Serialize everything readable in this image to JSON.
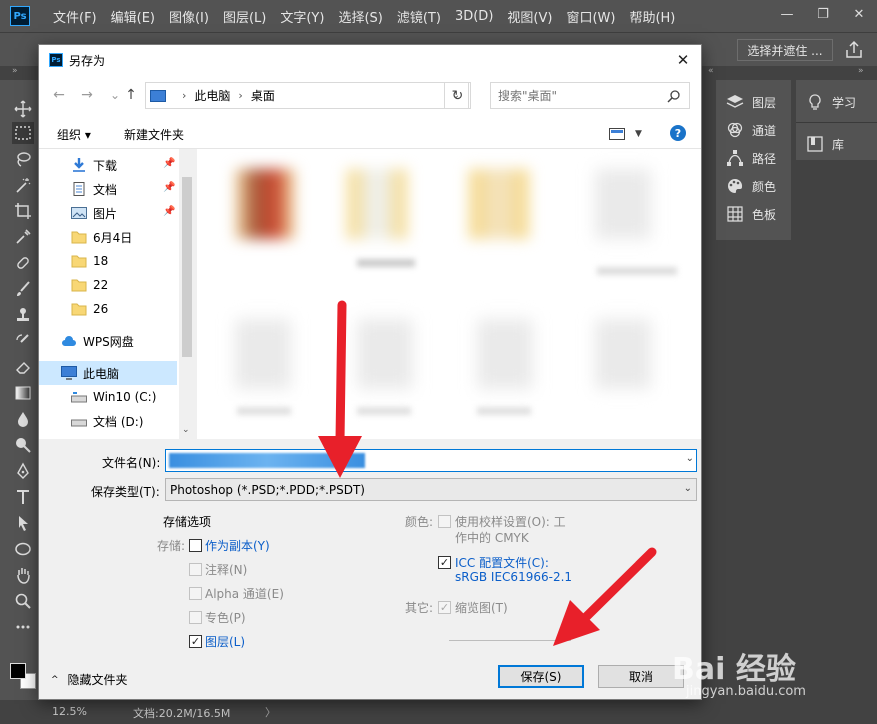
{
  "app": {
    "logo": "Ps",
    "menu": [
      "文件(F)",
      "编辑(E)",
      "图像(I)",
      "图层(L)",
      "文字(Y)",
      "选择(S)",
      "滤镜(T)",
      "3D(D)",
      "视图(V)",
      "窗口(W)",
      "帮助(H)"
    ],
    "window_controls": [
      "—",
      "❐",
      "✕"
    ],
    "select_mask_label": "选择并遮住 ...",
    "status": {
      "zoom": "12.5%",
      "doc": "文档:20.2M/16.5M",
      "arrow": "〉"
    }
  },
  "panels": {
    "mid": [
      "图层",
      "通道",
      "路径",
      "颜色",
      "色板"
    ],
    "right": [
      "学习",
      "库"
    ]
  },
  "dialog": {
    "title": "另存为",
    "close": "✕",
    "address": {
      "root": "此电脑",
      "current": "桌面"
    },
    "search_placeholder": "搜索\"桌面\"",
    "organize": "组织 ▾",
    "new_folder": "新建文件夹",
    "help": "?",
    "nav_items": [
      {
        "label": "下载",
        "icon": "download-icon",
        "pinned": true
      },
      {
        "label": "文档",
        "icon": "document-icon",
        "pinned": true
      },
      {
        "label": "图片",
        "icon": "pictures-icon",
        "pinned": true
      },
      {
        "label": "6月4日",
        "icon": "folder-icon",
        "pinned": false
      },
      {
        "label": "18",
        "icon": "folder-icon",
        "pinned": false
      },
      {
        "label": "22",
        "icon": "folder-icon",
        "pinned": false
      },
      {
        "label": "26",
        "icon": "folder-icon",
        "pinned": false
      },
      {
        "label": "WPS网盘",
        "icon": "cloud-icon",
        "pinned": false
      },
      {
        "label": "此电脑",
        "icon": "computer-icon",
        "pinned": false
      },
      {
        "label": "Win10 (C:)",
        "icon": "drive-icon",
        "pinned": false
      },
      {
        "label": "文档 (D:)",
        "icon": "drive-icon",
        "pinned": false
      }
    ],
    "filename_label": "文件名(N):",
    "filetype_label": "保存类型(T):",
    "filetype_value": "Photoshop (*.PSD;*.PDD;*.PSDT)",
    "storage_options_title": "存储选项",
    "storage_label": "存储:",
    "options_left": [
      {
        "label": "作为副本(Y)",
        "checked": false,
        "enabled": true
      },
      {
        "label": "注释(N)",
        "checked": false,
        "enabled": false
      },
      {
        "label": "Alpha 通道(E)",
        "checked": false,
        "enabled": false
      },
      {
        "label": "专色(P)",
        "checked": false,
        "enabled": false
      },
      {
        "label": "图层(L)",
        "checked": true,
        "enabled": true
      }
    ],
    "color_label": "颜色:",
    "proof_setup": {
      "line1": "使用校样设置(O):  工",
      "line2": "作中的 CMYK",
      "checked": false,
      "enabled": false
    },
    "icc_profile": {
      "line1": "ICC 配置文件(C):",
      "line2": "sRGB IEC61966-2.1",
      "checked": true,
      "enabled": true
    },
    "other_label": "其它:",
    "thumbnail": {
      "label": "缩览图(T)",
      "checked": true,
      "enabled": false
    },
    "save": "保存(S)",
    "cancel": "取消",
    "hide_folders": "隐藏文件夹"
  },
  "watermark": {
    "logo": "Bai 经验",
    "url": "jingyan.baidu.com"
  },
  "colors": {
    "accent": "#0078d7",
    "link": "#0b5ec9",
    "ps_bg": "#535353",
    "arrow": "#e8202a"
  }
}
